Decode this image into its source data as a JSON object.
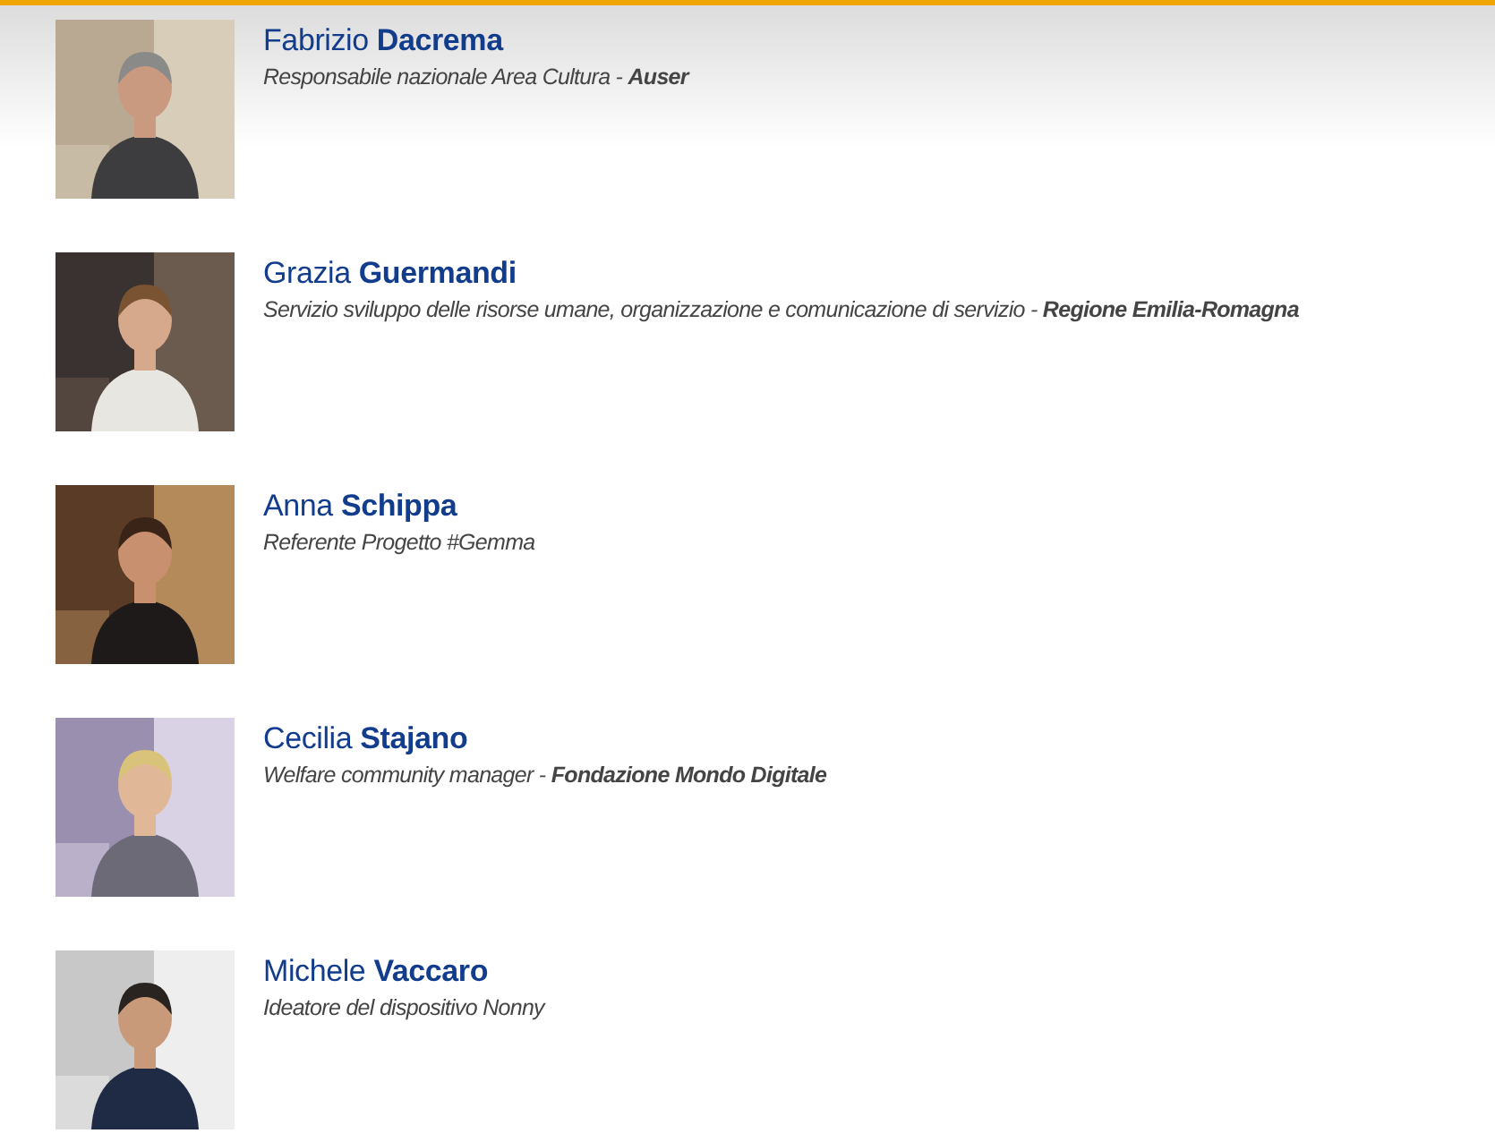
{
  "people": [
    {
      "kind": "picture",
      "name": "Fabrizio **Dacrema**",
      "role": "Responsabile nazionale Area Cultura - **Auser**"
    },
    {
      "kind": "picture",
      "name": "Grazia **Guermandi**",
      "role": "Servizio sviluppo delle risorse umane, organizzazione e comunicazione di servizio - **Regione Emilia-Romagna**"
    },
    {
      "kind": "picture",
      "name": "Anna **Schippa**",
      "role": "Referente Progetto #Gemma"
    },
    {
      "kind": "picture",
      "name": "Cecilia **Stajano**",
      "role": "Welfare community manager - **Fondazione Mondo Digitale**"
    },
    {
      "kind": "picture",
      "name": "Michele **Vaccaro**",
      "role": "Ideatore del dispositivo Nonny"
    }
  ]
}
